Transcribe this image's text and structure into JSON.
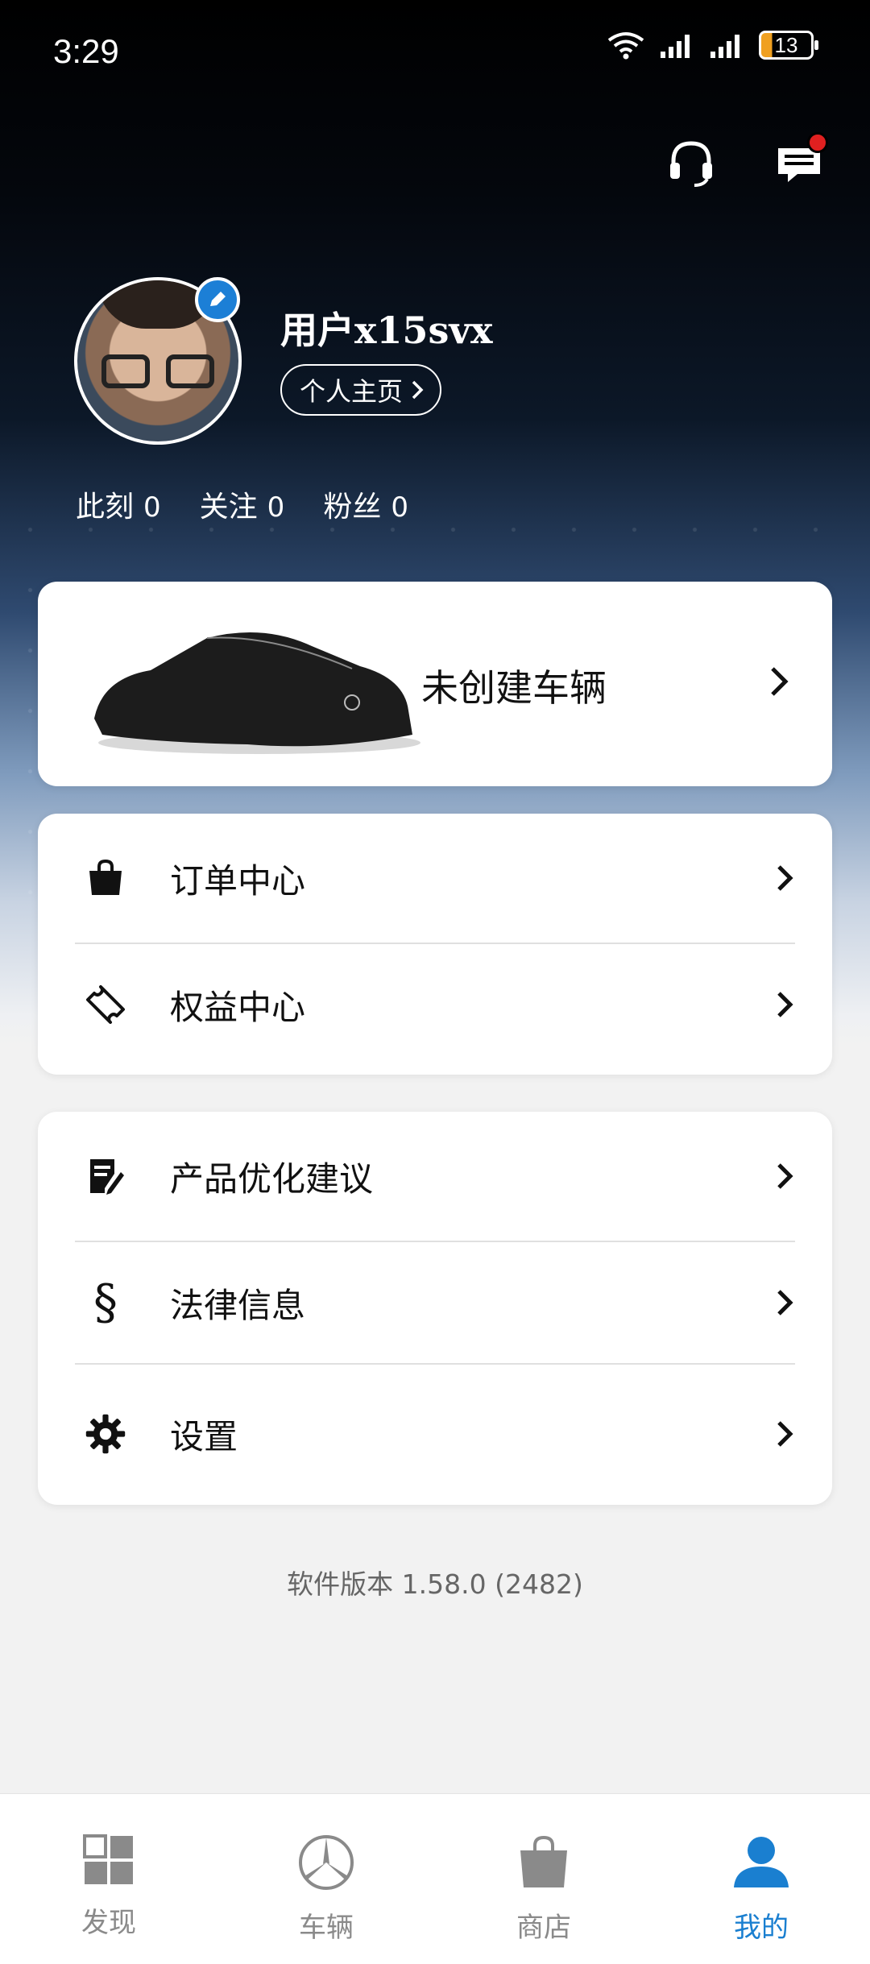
{
  "status_bar": {
    "time": "3:29",
    "battery": "13"
  },
  "profile": {
    "username": "用户x15svx",
    "profile_button": "个人主页",
    "stats": [
      {
        "label": "此刻",
        "value": "0"
      },
      {
        "label": "关注",
        "value": "0"
      },
      {
        "label": "粉丝",
        "value": "0"
      }
    ]
  },
  "vehicle_card": {
    "label": "未创建车辆"
  },
  "menu_group_1": [
    {
      "label": "订单中心",
      "icon": "shopping-bag-icon"
    },
    {
      "label": "权益中心",
      "icon": "ticket-icon"
    }
  ],
  "menu_group_2": [
    {
      "label": "产品优化建议",
      "icon": "feedback-icon"
    },
    {
      "label": "法律信息",
      "icon": "section-sign-icon"
    },
    {
      "label": "设置",
      "icon": "gear-icon"
    }
  ],
  "version": "软件版本 1.58.0 (2482)",
  "tabs": [
    {
      "label": "发现",
      "icon": "grid-icon",
      "active": false
    },
    {
      "label": "车辆",
      "icon": "star-logo-icon",
      "active": false
    },
    {
      "label": "商店",
      "icon": "bag-icon",
      "active": false
    },
    {
      "label": "我的",
      "icon": "person-icon",
      "active": true
    }
  ],
  "colors": {
    "accent": "#1a7fd0",
    "tab_inactive": "#8a8a8a",
    "notification": "#e02020"
  }
}
